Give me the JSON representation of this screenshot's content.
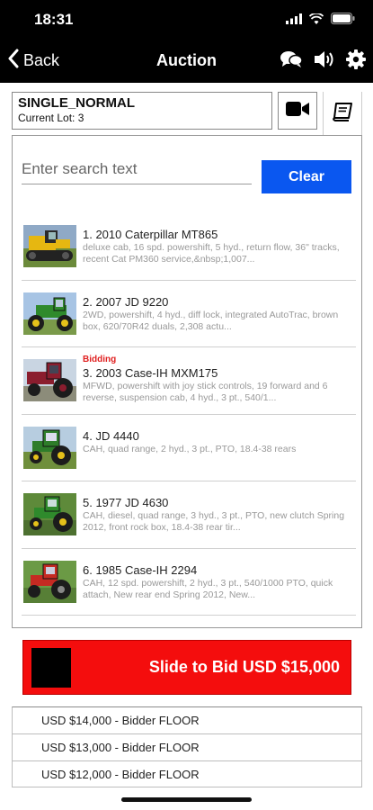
{
  "status_bar": {
    "time": "18:31"
  },
  "nav": {
    "back_label": "Back",
    "title": "Auction",
    "icons": [
      "back-chevron-icon",
      "chat-bubbles-icon",
      "speaker-icon",
      "gear-icon"
    ]
  },
  "sale": {
    "name": "SINGLE_NORMAL",
    "current_lot": "Current Lot: 3"
  },
  "search": {
    "placeholder": "Enter search text",
    "value": "",
    "clear_label": "Clear"
  },
  "lots": [
    {
      "title": "1. 2010 Caterpillar MT865",
      "description": "deluxe cab, 16 spd. powershift, 5 hyd., return flow, 36\" tracks, recent Cat PM360 service,&nbsp;1,007...",
      "bidding": ""
    },
    {
      "title": "2. 2007 JD 9220",
      "description": "2WD, powershift, 4 hyd., diff lock, integrated AutoTrac, brown box, 620/70R42 duals, 2,308 actu...",
      "bidding": ""
    },
    {
      "title": "3. 2003 Case-IH MXM175",
      "description": "MFWD, powershift with joy stick controls, 19 forward and 6 reverse, suspension cab, 4 hyd., 3 pt., 540/1...",
      "bidding": "Bidding"
    },
    {
      "title": "4. JD 4440",
      "description": "CAH, quad range, 2 hyd., 3 pt., PTO, 18.4-38 rears",
      "bidding": ""
    },
    {
      "title": "5. 1977 JD 4630",
      "description": "CAH, diesel, quad range, 3 hyd., 3 pt., PTO, new clutch Spring 2012, front rock box, 18.4-38 rear tir...",
      "bidding": ""
    },
    {
      "title": "6. 1985 Case-IH 2294",
      "description": "CAH, 12 spd. powershift, 2 hyd., 3 pt., 540/1000 PTO, quick attach, New rear end Spring 2012, New...",
      "bidding": ""
    }
  ],
  "slide_to_bid": {
    "label": "Slide to Bid USD $15,000"
  },
  "bid_history": [
    "USD $14,000 - Bidder FLOOR",
    "USD $13,000 - Bidder FLOOR",
    "USD $12,000 - Bidder FLOOR"
  ],
  "colors": {
    "accent_blue": "#0a57f0",
    "bid_red": "#f40d0d",
    "bidding_text": "#e02020",
    "bar_black": "#000000"
  }
}
